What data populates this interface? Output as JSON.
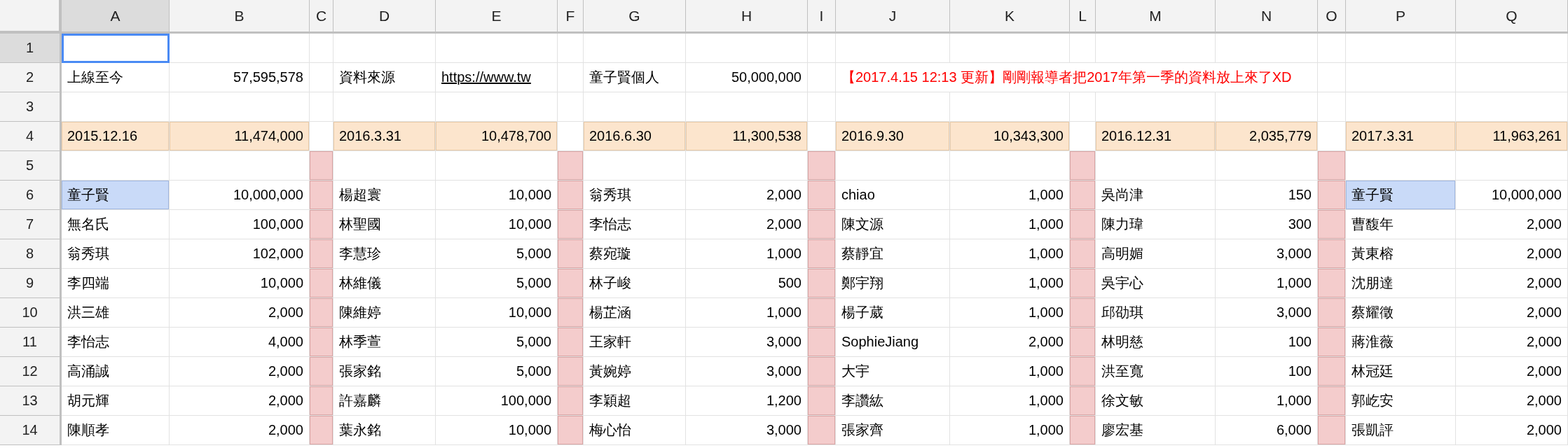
{
  "columns": [
    {
      "label": "A",
      "selected": true
    },
    {
      "label": "B",
      "selected": false
    },
    {
      "label": "C",
      "selected": false
    },
    {
      "label": "D",
      "selected": false
    },
    {
      "label": "E",
      "selected": false
    },
    {
      "label": "F",
      "selected": false
    },
    {
      "label": "G",
      "selected": false
    },
    {
      "label": "H",
      "selected": false
    },
    {
      "label": "I",
      "selected": false
    },
    {
      "label": "J",
      "selected": false
    },
    {
      "label": "K",
      "selected": false
    },
    {
      "label": "L",
      "selected": false
    },
    {
      "label": "M",
      "selected": false
    },
    {
      "label": "N",
      "selected": false
    },
    {
      "label": "O",
      "selected": false
    },
    {
      "label": "P",
      "selected": false
    },
    {
      "label": "Q",
      "selected": false
    }
  ],
  "rows": [
    {
      "label": "1",
      "selected": true,
      "cells": [
        null,
        null,
        null,
        null,
        null,
        null,
        null,
        null,
        null,
        null,
        null,
        null,
        null,
        null,
        null,
        null,
        null
      ]
    },
    {
      "label": "2",
      "selected": false,
      "cells": [
        {
          "kind": "text",
          "text": "上線至今"
        },
        {
          "kind": "number",
          "text": "57,595,578"
        },
        null,
        {
          "kind": "text",
          "text": "資料來源"
        },
        {
          "kind": "link",
          "text": "https://www.tw"
        },
        null,
        {
          "kind": "text",
          "text": "童子賢個人"
        },
        {
          "kind": "number",
          "text": "50,000,000"
        },
        null,
        {
          "kind": "note",
          "text": "【2017.4.15 12:13 更新】剛剛報導者把2017年第一季的資料放上來了XD"
        },
        null,
        null,
        null,
        null,
        null,
        null,
        null
      ]
    },
    {
      "label": "3",
      "selected": false,
      "cells": [
        null,
        null,
        null,
        null,
        null,
        null,
        null,
        null,
        null,
        null,
        null,
        null,
        null,
        null,
        null,
        null,
        null
      ]
    },
    {
      "label": "4",
      "selected": false,
      "cells": [
        {
          "kind": "text",
          "text": "2015.12.16",
          "color": "#fce5cd"
        },
        {
          "kind": "number",
          "text": "11,474,000",
          "color": "#fce5cd"
        },
        null,
        {
          "kind": "text",
          "text": "2016.3.31",
          "color": "#fce5cd"
        },
        {
          "kind": "number",
          "text": "10,478,700",
          "color": "#fce5cd"
        },
        null,
        {
          "kind": "text",
          "text": "2016.6.30",
          "color": "#fce5cd"
        },
        {
          "kind": "number",
          "text": "11,300,538",
          "color": "#fce5cd"
        },
        null,
        {
          "kind": "text",
          "text": "2016.9.30",
          "color": "#fce5cd"
        },
        {
          "kind": "number",
          "text": "10,343,300",
          "color": "#fce5cd"
        },
        null,
        {
          "kind": "text",
          "text": "2016.12.31",
          "color": "#fce5cd"
        },
        {
          "kind": "number",
          "text": "2,035,779",
          "color": "#fce5cd"
        },
        null,
        {
          "kind": "text",
          "text": "2017.3.31",
          "color": "#fce5cd"
        },
        {
          "kind": "number",
          "text": "11,963,261",
          "color": "#fce5cd"
        }
      ]
    },
    {
      "label": "5",
      "selected": false,
      "cells": [
        null,
        null,
        {
          "kind": "blank",
          "color": "#f4cccc"
        },
        null,
        null,
        {
          "kind": "blank",
          "color": "#f4cccc"
        },
        null,
        null,
        {
          "kind": "blank",
          "color": "#f4cccc"
        },
        null,
        null,
        {
          "kind": "blank",
          "color": "#f4cccc"
        },
        null,
        null,
        {
          "kind": "blank",
          "color": "#f4cccc"
        },
        null,
        null
      ]
    },
    {
      "label": "6",
      "selected": false,
      "cells": [
        {
          "kind": "text",
          "text": "童子賢",
          "color": "#c9daf8"
        },
        {
          "kind": "number",
          "text": "10,000,000"
        },
        {
          "kind": "blank",
          "color": "#f4cccc"
        },
        {
          "kind": "text",
          "text": "楊超寰"
        },
        {
          "kind": "number",
          "text": "10,000"
        },
        {
          "kind": "blank",
          "color": "#f4cccc"
        },
        {
          "kind": "text",
          "text": "翁秀琪"
        },
        {
          "kind": "number",
          "text": "2,000"
        },
        {
          "kind": "blank",
          "color": "#f4cccc"
        },
        {
          "kind": "text",
          "text": "chiao"
        },
        {
          "kind": "number",
          "text": "1,000"
        },
        {
          "kind": "blank",
          "color": "#f4cccc"
        },
        {
          "kind": "text",
          "text": "吳尚津"
        },
        {
          "kind": "number",
          "text": "150"
        },
        {
          "kind": "blank",
          "color": "#f4cccc"
        },
        {
          "kind": "text",
          "text": "童子賢",
          "color": "#c9daf8"
        },
        {
          "kind": "number",
          "text": "10,000,000"
        }
      ]
    },
    {
      "label": "7",
      "selected": false,
      "cells": [
        {
          "kind": "text",
          "text": "無名氏"
        },
        {
          "kind": "number",
          "text": "100,000"
        },
        {
          "kind": "blank",
          "color": "#f4cccc"
        },
        {
          "kind": "text",
          "text": "林聖國"
        },
        {
          "kind": "number",
          "text": "10,000"
        },
        {
          "kind": "blank",
          "color": "#f4cccc"
        },
        {
          "kind": "text",
          "text": "李怡志"
        },
        {
          "kind": "number",
          "text": "2,000"
        },
        {
          "kind": "blank",
          "color": "#f4cccc"
        },
        {
          "kind": "text",
          "text": "陳文源"
        },
        {
          "kind": "number",
          "text": "1,000"
        },
        {
          "kind": "blank",
          "color": "#f4cccc"
        },
        {
          "kind": "text",
          "text": "陳力瑋"
        },
        {
          "kind": "number",
          "text": "300"
        },
        {
          "kind": "blank",
          "color": "#f4cccc"
        },
        {
          "kind": "text",
          "text": "曹馥年"
        },
        {
          "kind": "number",
          "text": "2,000"
        }
      ]
    },
    {
      "label": "8",
      "selected": false,
      "cells": [
        {
          "kind": "text",
          "text": "翁秀琪"
        },
        {
          "kind": "number",
          "text": "102,000"
        },
        {
          "kind": "blank",
          "color": "#f4cccc"
        },
        {
          "kind": "text",
          "text": "李慧珍"
        },
        {
          "kind": "number",
          "text": "5,000"
        },
        {
          "kind": "blank",
          "color": "#f4cccc"
        },
        {
          "kind": "text",
          "text": "蔡宛璇"
        },
        {
          "kind": "number",
          "text": "1,000"
        },
        {
          "kind": "blank",
          "color": "#f4cccc"
        },
        {
          "kind": "text",
          "text": "蔡靜宜"
        },
        {
          "kind": "number",
          "text": "1,000"
        },
        {
          "kind": "blank",
          "color": "#f4cccc"
        },
        {
          "kind": "text",
          "text": "高明媚"
        },
        {
          "kind": "number",
          "text": "3,000"
        },
        {
          "kind": "blank",
          "color": "#f4cccc"
        },
        {
          "kind": "text",
          "text": "黃東榕"
        },
        {
          "kind": "number",
          "text": "2,000"
        }
      ]
    },
    {
      "label": "9",
      "selected": false,
      "cells": [
        {
          "kind": "text",
          "text": "李四端"
        },
        {
          "kind": "number",
          "text": "10,000"
        },
        {
          "kind": "blank",
          "color": "#f4cccc"
        },
        {
          "kind": "text",
          "text": "林維儀"
        },
        {
          "kind": "number",
          "text": "5,000"
        },
        {
          "kind": "blank",
          "color": "#f4cccc"
        },
        {
          "kind": "text",
          "text": "林子峻"
        },
        {
          "kind": "number",
          "text": "500"
        },
        {
          "kind": "blank",
          "color": "#f4cccc"
        },
        {
          "kind": "text",
          "text": "鄭宇翔"
        },
        {
          "kind": "number",
          "text": "1,000"
        },
        {
          "kind": "blank",
          "color": "#f4cccc"
        },
        {
          "kind": "text",
          "text": "吳宇心"
        },
        {
          "kind": "number",
          "text": "1,000"
        },
        {
          "kind": "blank",
          "color": "#f4cccc"
        },
        {
          "kind": "text",
          "text": "沈朋達"
        },
        {
          "kind": "number",
          "text": "2,000"
        }
      ]
    },
    {
      "label": "10",
      "selected": false,
      "cells": [
        {
          "kind": "text",
          "text": "洪三雄"
        },
        {
          "kind": "number",
          "text": "2,000"
        },
        {
          "kind": "blank",
          "color": "#f4cccc"
        },
        {
          "kind": "text",
          "text": "陳維婷"
        },
        {
          "kind": "number",
          "text": "10,000"
        },
        {
          "kind": "blank",
          "color": "#f4cccc"
        },
        {
          "kind": "text",
          "text": "楊芷涵"
        },
        {
          "kind": "number",
          "text": "1,000"
        },
        {
          "kind": "blank",
          "color": "#f4cccc"
        },
        {
          "kind": "text",
          "text": "楊子葳"
        },
        {
          "kind": "number",
          "text": "1,000"
        },
        {
          "kind": "blank",
          "color": "#f4cccc"
        },
        {
          "kind": "text",
          "text": "邱劭琪"
        },
        {
          "kind": "number",
          "text": "3,000"
        },
        {
          "kind": "blank",
          "color": "#f4cccc"
        },
        {
          "kind": "text",
          "text": "蔡耀徵"
        },
        {
          "kind": "number",
          "text": "2,000"
        }
      ]
    },
    {
      "label": "11",
      "selected": false,
      "cells": [
        {
          "kind": "text",
          "text": "李怡志"
        },
        {
          "kind": "number",
          "text": "4,000"
        },
        {
          "kind": "blank",
          "color": "#f4cccc"
        },
        {
          "kind": "text",
          "text": "林季萱"
        },
        {
          "kind": "number",
          "text": "5,000"
        },
        {
          "kind": "blank",
          "color": "#f4cccc"
        },
        {
          "kind": "text",
          "text": "王家軒"
        },
        {
          "kind": "number",
          "text": "3,000"
        },
        {
          "kind": "blank",
          "color": "#f4cccc"
        },
        {
          "kind": "text",
          "text": "SophieJiang"
        },
        {
          "kind": "number",
          "text": "2,000"
        },
        {
          "kind": "blank",
          "color": "#f4cccc"
        },
        {
          "kind": "text",
          "text": "林明慈"
        },
        {
          "kind": "number",
          "text": "100"
        },
        {
          "kind": "blank",
          "color": "#f4cccc"
        },
        {
          "kind": "text",
          "text": "蔣淮薇"
        },
        {
          "kind": "number",
          "text": "2,000"
        }
      ]
    },
    {
      "label": "12",
      "selected": false,
      "cells": [
        {
          "kind": "text",
          "text": "高涌誠"
        },
        {
          "kind": "number",
          "text": "2,000"
        },
        {
          "kind": "blank",
          "color": "#f4cccc"
        },
        {
          "kind": "text",
          "text": "張家銘"
        },
        {
          "kind": "number",
          "text": "5,000"
        },
        {
          "kind": "blank",
          "color": "#f4cccc"
        },
        {
          "kind": "text",
          "text": "黃婉婷"
        },
        {
          "kind": "number",
          "text": "3,000"
        },
        {
          "kind": "blank",
          "color": "#f4cccc"
        },
        {
          "kind": "text",
          "text": "大宇"
        },
        {
          "kind": "number",
          "text": "1,000"
        },
        {
          "kind": "blank",
          "color": "#f4cccc"
        },
        {
          "kind": "text",
          "text": "洪至寬"
        },
        {
          "kind": "number",
          "text": "100"
        },
        {
          "kind": "blank",
          "color": "#f4cccc"
        },
        {
          "kind": "text",
          "text": "林冠廷"
        },
        {
          "kind": "number",
          "text": "2,000"
        }
      ]
    },
    {
      "label": "13",
      "selected": false,
      "cells": [
        {
          "kind": "text",
          "text": "胡元輝"
        },
        {
          "kind": "number",
          "text": "2,000"
        },
        {
          "kind": "blank",
          "color": "#f4cccc"
        },
        {
          "kind": "text",
          "text": "許嘉麟"
        },
        {
          "kind": "number",
          "text": "100,000"
        },
        {
          "kind": "blank",
          "color": "#f4cccc"
        },
        {
          "kind": "text",
          "text": "李穎超"
        },
        {
          "kind": "number",
          "text": "1,200"
        },
        {
          "kind": "blank",
          "color": "#f4cccc"
        },
        {
          "kind": "text",
          "text": "李讚紘"
        },
        {
          "kind": "number",
          "text": "1,000"
        },
        {
          "kind": "blank",
          "color": "#f4cccc"
        },
        {
          "kind": "text",
          "text": "徐文敏"
        },
        {
          "kind": "number",
          "text": "1,000"
        },
        {
          "kind": "blank",
          "color": "#f4cccc"
        },
        {
          "kind": "text",
          "text": "郭屹安"
        },
        {
          "kind": "number",
          "text": "2,000"
        }
      ]
    },
    {
      "label": "14",
      "selected": false,
      "cells": [
        {
          "kind": "text",
          "text": "陳順孝"
        },
        {
          "kind": "number",
          "text": "2,000"
        },
        {
          "kind": "blank",
          "color": "#f4cccc"
        },
        {
          "kind": "text",
          "text": "葉永銘"
        },
        {
          "kind": "number",
          "text": "10,000"
        },
        {
          "kind": "blank",
          "color": "#f4cccc"
        },
        {
          "kind": "text",
          "text": "梅心怡"
        },
        {
          "kind": "number",
          "text": "3,000"
        },
        {
          "kind": "blank",
          "color": "#f4cccc"
        },
        {
          "kind": "text",
          "text": "張家齊"
        },
        {
          "kind": "number",
          "text": "1,000"
        },
        {
          "kind": "blank",
          "color": "#f4cccc"
        },
        {
          "kind": "text",
          "text": "廖宏基"
        },
        {
          "kind": "number",
          "text": "6,000"
        },
        {
          "kind": "blank",
          "color": "#f4cccc"
        },
        {
          "kind": "text",
          "text": "張凱評"
        },
        {
          "kind": "number",
          "text": "2,000"
        }
      ]
    }
  ]
}
